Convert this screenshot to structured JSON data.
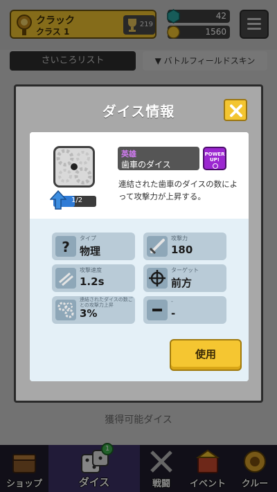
{
  "player": {
    "name": "クラック",
    "class": "クラス 1",
    "trophies": "219"
  },
  "currency": {
    "gems": "42",
    "gold": "1560"
  },
  "tabs": {
    "dice_list": "さいころリスト",
    "battlefield_skin": "▼ バトルフィールドスキン"
  },
  "acquirable_label": "獲得可能ダイス",
  "modal": {
    "title": "ダイス情報",
    "dice": {
      "grade": "英雄",
      "name": "歯車のダイス",
      "level_text": "1/2",
      "level_progress": 0.5,
      "power_up": "POWER UP!",
      "description": "連結された歯車のダイスの数によって攻撃力が上昇する。"
    },
    "stats": [
      {
        "label": "タイプ",
        "value": "物理",
        "icon": "question-icon"
      },
      {
        "label": "攻撃力",
        "value": "180",
        "icon": "sword-icon"
      },
      {
        "label": "攻撃速度",
        "value": "1.2s",
        "icon": "speed-icon"
      },
      {
        "label": "ターゲット",
        "value": "前方",
        "icon": "target-icon"
      },
      {
        "label": "連結されたダイスの数ごとの攻撃力上昇",
        "value": "3%",
        "icon": "gears-icon"
      },
      {
        "label": "-",
        "value": "-",
        "icon": "minus-icon"
      }
    ],
    "use_button": "使用"
  },
  "bottom_nav": [
    {
      "label": "ショップ",
      "icon": "shop-icon"
    },
    {
      "label": "ダイス",
      "icon": "dice-icon",
      "badge": "1"
    },
    {
      "label": "戦闘",
      "icon": "battle-icon"
    },
    {
      "label": "イベント",
      "icon": "event-icon"
    },
    {
      "label": "クルー",
      "icon": "crew-icon"
    }
  ]
}
